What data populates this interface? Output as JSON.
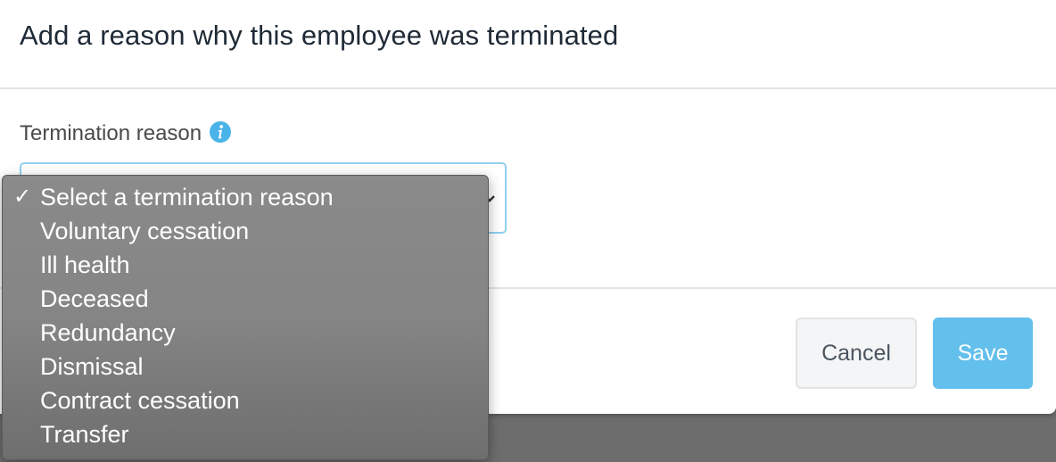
{
  "dialog": {
    "title": "Add a reason why this employee was terminated"
  },
  "field": {
    "label": "Termination reason",
    "info_icon": "info-circle-icon",
    "selected_value": "Select a termination reason",
    "options": [
      "Select a termination reason",
      "Voluntary cessation",
      "Ill health",
      "Deceased",
      "Redundancy",
      "Dismissal",
      "Contract cessation",
      "Transfer"
    ]
  },
  "footer": {
    "cancel_label": "Cancel",
    "save_label": "Save"
  },
  "colors": {
    "accent": "#63bfec",
    "info_icon": "#4ab3e8",
    "title_text": "#1f2a36",
    "dropdown_bg": "#858585"
  }
}
